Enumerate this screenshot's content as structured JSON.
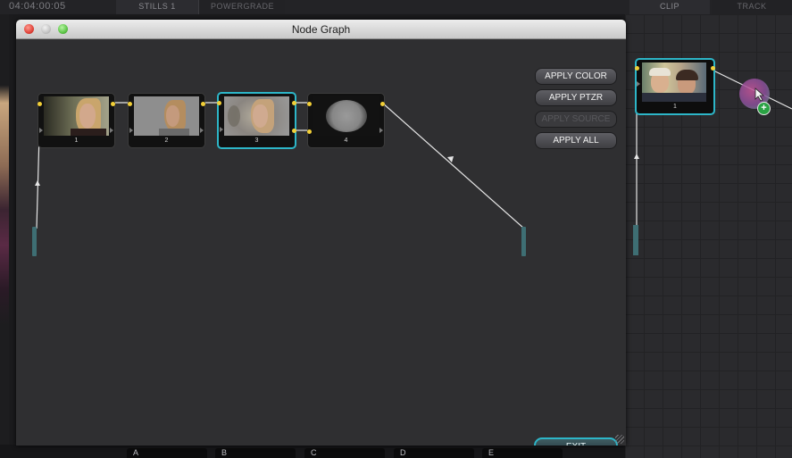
{
  "app": {
    "timecode": "04:04:00:05",
    "tabs_left": [
      "STILLS 1",
      "POWERGRADE"
    ],
    "tabs_right": [
      "CLIP",
      "TRACK"
    ],
    "gallery_slots": [
      "A",
      "B",
      "C",
      "D",
      "E"
    ]
  },
  "dialog": {
    "title": "Node Graph",
    "buttons": {
      "apply_color": "APPLY COLOR",
      "apply_ptzr": "APPLY PTZR",
      "apply_source": "APPLY SOURCE",
      "apply_all": "APPLY ALL",
      "exit": "EXIT"
    },
    "nodes": [
      {
        "label": "1",
        "selected": false
      },
      {
        "label": "2",
        "selected": false
      },
      {
        "label": "3",
        "selected": true
      },
      {
        "label": "4",
        "selected": false
      }
    ]
  },
  "clip_node": {
    "label": "1",
    "selected": true
  },
  "colors": {
    "accent": "#2db6c8",
    "port": "#f2cf37",
    "add_badge": "#2aa244"
  }
}
